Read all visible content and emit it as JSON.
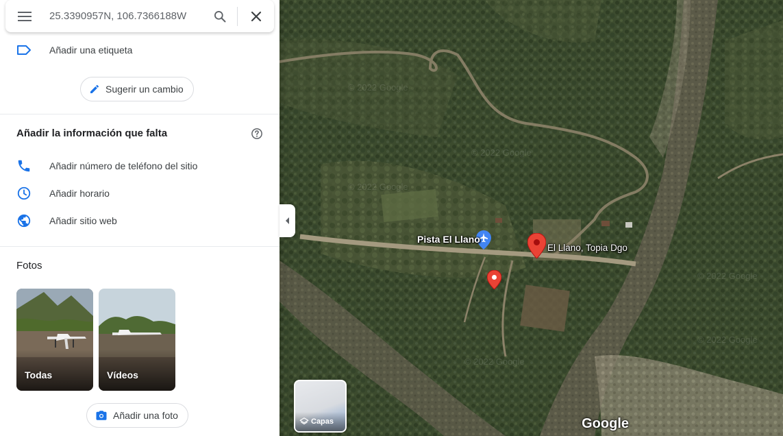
{
  "search": {
    "value": "25.3390957N, 106.7366188W"
  },
  "actions": {
    "add_label": "Añadir una etiqueta",
    "suggest_edit": "Sugerir un cambio"
  },
  "missing_info": {
    "title": "Añadir la información que falta",
    "items": [
      {
        "label": "Añadir número de teléfono del sitio",
        "icon": "phone-icon"
      },
      {
        "label": "Añadir horario",
        "icon": "clock-icon"
      },
      {
        "label": "Añadir sitio web",
        "icon": "globe-icon"
      }
    ]
  },
  "photos": {
    "title": "Fotos",
    "tiles": [
      {
        "label": "Todas"
      },
      {
        "label": "Vídeos"
      }
    ],
    "add_photo": "Añadir una foto"
  },
  "map": {
    "labels": {
      "airstrip": "Pista El Llano",
      "place": "El Llano, Topia Dgo"
    },
    "layers_label": "Capas",
    "logo": "Google",
    "watermark": "© 2022 Google"
  },
  "colors": {
    "accent": "#1a73e8",
    "pin_red": "#ea4335",
    "airport_blue": "#4285f4"
  }
}
